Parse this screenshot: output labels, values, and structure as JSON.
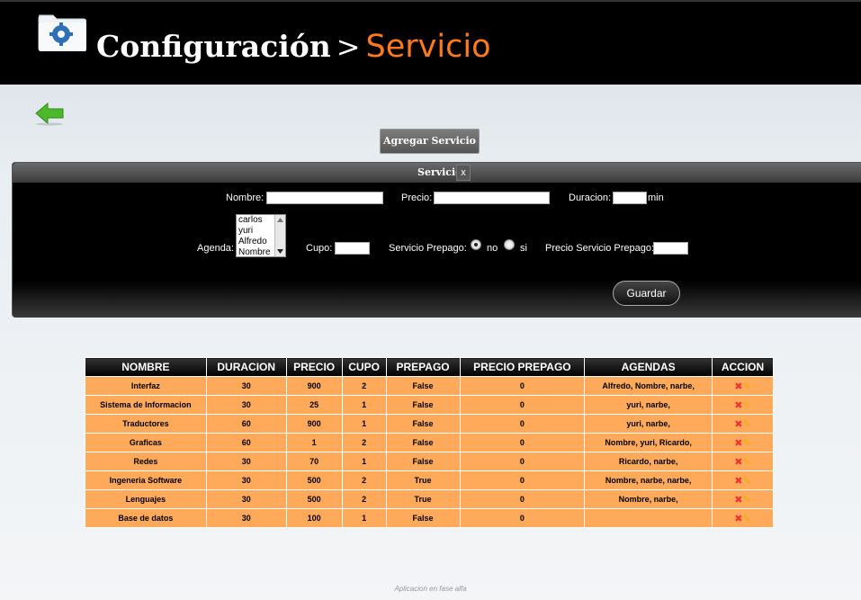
{
  "header": {
    "crumb_parent": "Configuración",
    "separator": ">",
    "crumb_current": "Servicio",
    "accent_color": "#ff7a1c"
  },
  "icons": {
    "folder": "settings-folder-icon",
    "back": "back-arrow-icon",
    "delete": "delete-icon",
    "edit": "edit-icon"
  },
  "toolbar": {
    "add_label": "Agregar Servicio"
  },
  "form": {
    "title": "Servicio",
    "close": "x",
    "nombre_label": "Nombre:",
    "nombre_value": "",
    "precio_label": "Precio:",
    "precio_value": "",
    "duracion_label": "Duracion:",
    "duracion_value": "",
    "duracion_unit": "min",
    "agenda_label": "Agenda:",
    "agenda_options": [
      "carlos",
      "yuri",
      "Alfredo",
      "Nombre"
    ],
    "cupo_label": "Cupo:",
    "cupo_value": "",
    "prepago_label": "Servicio Prepago:",
    "prepago_no": "no",
    "prepago_si": "si",
    "prepago_selected": "no",
    "precio_prepago_label": "Precio Servicio Prepago:",
    "precio_prepago_value": "",
    "save_label": "Guardar"
  },
  "table": {
    "headers": [
      "NOMBRE",
      "DURACION",
      "PRECIO",
      "CUPO",
      "PREPAGO",
      "PRECIO PREPAGO",
      "AGENDAS",
      "ACCION"
    ],
    "rows": [
      {
        "nombre": "Interfaz",
        "duracion": "30",
        "precio": "900",
        "cupo": "2",
        "prepago": "False",
        "precio_prepago": "0",
        "agendas": "Alfredo, Nombre, narbe,"
      },
      {
        "nombre": "Sistema de Informacion",
        "duracion": "30",
        "precio": "25",
        "cupo": "1",
        "prepago": "False",
        "precio_prepago": "0",
        "agendas": "yuri, narbe,"
      },
      {
        "nombre": "Traductores",
        "duracion": "60",
        "precio": "900",
        "cupo": "1",
        "prepago": "False",
        "precio_prepago": "0",
        "agendas": "yuri, narbe,"
      },
      {
        "nombre": "Graficas",
        "duracion": "60",
        "precio": "1",
        "cupo": "2",
        "prepago": "False",
        "precio_prepago": "0",
        "agendas": "Nombre, yuri, Ricardo,"
      },
      {
        "nombre": "Redes",
        "duracion": "30",
        "precio": "70",
        "cupo": "1",
        "prepago": "False",
        "precio_prepago": "0",
        "agendas": "Ricardo, narbe,"
      },
      {
        "nombre": "Ingeneria Software",
        "duracion": "30",
        "precio": "500",
        "cupo": "2",
        "prepago": "True",
        "precio_prepago": "0",
        "agendas": "Nombre, narbe, narbe,"
      },
      {
        "nombre": "Lenguajes",
        "duracion": "30",
        "precio": "500",
        "cupo": "2",
        "prepago": "True",
        "precio_prepago": "0",
        "agendas": "Nombre, narbe,"
      },
      {
        "nombre": "Base de datos",
        "duracion": "30",
        "precio": "100",
        "cupo": "1",
        "prepago": "False",
        "precio_prepago": "0",
        "agendas": ""
      }
    ]
  },
  "footer": {
    "text": "Aplicacion en fase alfa"
  }
}
